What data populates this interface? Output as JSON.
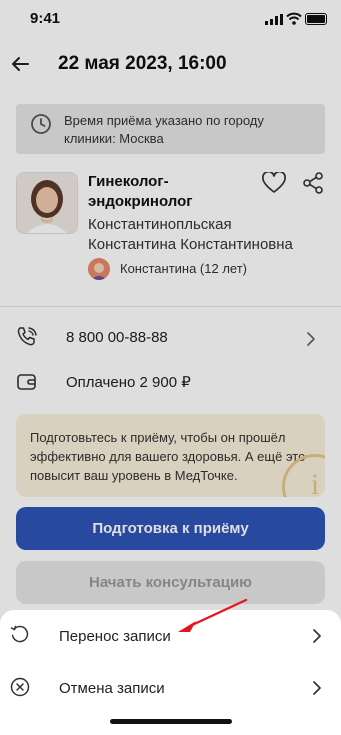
{
  "status_bar": {
    "time": "9:41"
  },
  "header": {
    "title": "22 мая 2023, 16:00"
  },
  "notice": {
    "text": "Время приёма указано по городу клиники: Москва"
  },
  "doctor": {
    "specialty": "Гинеколог-эндокринолог",
    "name": "Константинопльская Константина Константиновна"
  },
  "patient": {
    "label": "Константина (12 лет)"
  },
  "contact": {
    "phone": "8 800 00-88-88"
  },
  "payment": {
    "label": "Оплачено 2 900 ₽"
  },
  "prep_card": {
    "text": "Подготовьтесь к приёму, чтобы он прошёл эффективно для вашего здоровья. А ещё это повысит ваш уровень в МедТочке."
  },
  "buttons": {
    "prepare": "Подготовка к приёму",
    "start": "Начать консультацию"
  },
  "sheet": {
    "reschedule": "Перенос записи",
    "cancel": "Отмена записи"
  },
  "colors": {
    "primary": "#2d55b8",
    "notice_bg": "#e6e6e6",
    "prep_bg": "#f9f0dc",
    "arrow": "#e8141c"
  }
}
